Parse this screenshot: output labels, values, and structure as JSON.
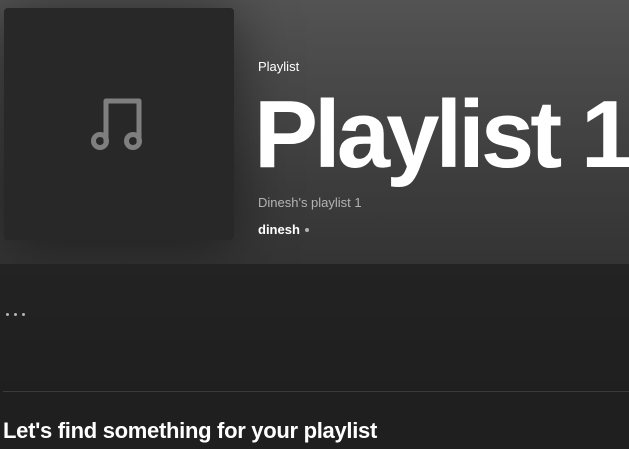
{
  "playlist": {
    "type_label": "Playlist",
    "title": "Playlist 1",
    "description": "Dinesh's playlist 1",
    "owner": "dinesh",
    "cover_icon": "music-note-icon"
  },
  "actions": {
    "more_icon": "more-options-icon"
  },
  "search_section": {
    "heading": "Let's find something for your playlist"
  },
  "colors": {
    "hero_gradient_top": "#535353",
    "hero_gradient_bottom": "#343434",
    "background": "#1f1f1f",
    "cover_bg": "#282828",
    "secondary_text": "#b3b3b3",
    "icon_color": "#7f7f7f"
  }
}
